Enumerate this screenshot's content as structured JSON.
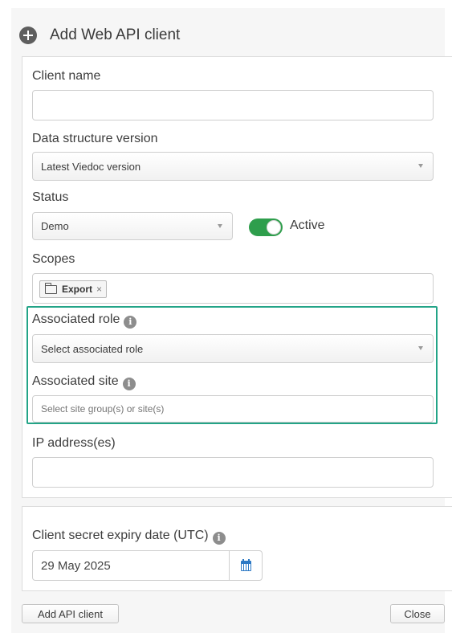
{
  "dialog": {
    "title": "Add Web API client"
  },
  "form": {
    "client_name": {
      "label": "Client name",
      "value": "",
      "placeholder": ""
    },
    "data_structure_version": {
      "label": "Data structure version",
      "selected": "Latest Viedoc version"
    },
    "status": {
      "label": "Status",
      "selected": "Demo",
      "toggle_label": "Active",
      "toggle_on": true
    },
    "scopes": {
      "label": "Scopes",
      "tags": [
        {
          "label": "Export",
          "remove": "×"
        }
      ]
    },
    "associated_role": {
      "label": "Associated role",
      "placeholder": "Select associated role"
    },
    "associated_site": {
      "label": "Associated site",
      "placeholder": "Select site group(s) or site(s)"
    },
    "ip_addresses": {
      "label": "IP address(es)",
      "value": ""
    }
  },
  "expiry": {
    "label": "Client secret expiry date (UTC)",
    "value": "29 May 2025"
  },
  "footer": {
    "add_label": "Add API client",
    "close_label": "Close"
  },
  "icons": {
    "info": "info-icon",
    "add": "plus-circle-icon",
    "calendar": "calendar-icon",
    "folder": "folder-icon"
  },
  "colors": {
    "toggle_on": "#2e9e4c",
    "highlight_border": "#23a487",
    "calendar_icon": "#2b78c4"
  }
}
